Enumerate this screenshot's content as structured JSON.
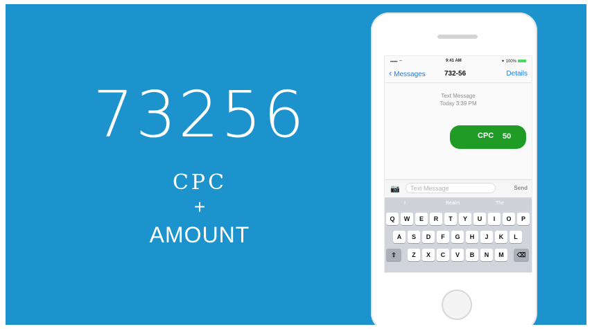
{
  "banner": {
    "code": "73256",
    "keyword": "CPC",
    "plus": "+",
    "amount_label": "AMOUNT",
    "bg_color": "#1d93cd"
  },
  "phone": {
    "status": {
      "carrier": "••••• ⌔",
      "time": "9:41 AM",
      "battery": "✦ 100%"
    },
    "nav": {
      "back_label": "Messages",
      "title": "732-56",
      "details_label": "Details"
    },
    "thread_meta": {
      "line1": "Text Message",
      "line2": "Today 3:39 PM"
    },
    "bubble": {
      "keyword": "CPC",
      "value": "50",
      "color": "#1f9b26"
    },
    "input": {
      "placeholder": "Text Message",
      "send_label": "Send"
    },
    "keyboard": {
      "suggestions": [
        "I",
        "Realm",
        "The"
      ],
      "row1": [
        "Q",
        "W",
        "E",
        "R",
        "T",
        "Y",
        "U",
        "I",
        "O",
        "P"
      ],
      "row2": [
        "A",
        "S",
        "D",
        "F",
        "G",
        "H",
        "J",
        "K",
        "L"
      ],
      "row3": [
        "Z",
        "X",
        "C",
        "V",
        "B",
        "N",
        "M"
      ],
      "shift_icon": "shift-icon",
      "delete_icon": "delete-icon"
    }
  }
}
